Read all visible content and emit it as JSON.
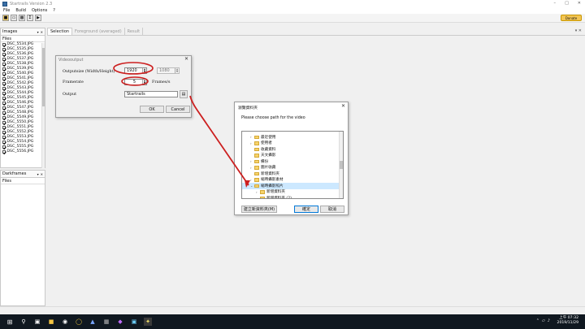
{
  "window": {
    "title": "Startrails Version 2.3"
  },
  "menu": [
    "File",
    "Build",
    "Options",
    "?"
  ],
  "toolbar": {
    "donate_label": "Donate"
  },
  "images_panel": {
    "title": "Images",
    "column": "Files",
    "files": [
      "DSC_5534.JPG",
      "DSC_5535.JPG",
      "DSC_5536.JPG",
      "DSC_5537.JPG",
      "DSC_5538.JPG",
      "DSC_5539.JPG",
      "DSC_5540.JPG",
      "DSC_5541.JPG",
      "DSC_5542.JPG",
      "DSC_5543.JPG",
      "DSC_5544.JPG",
      "DSC_5545.JPG",
      "DSC_5546.JPG",
      "DSC_5547.JPG",
      "DSC_5548.JPG",
      "DSC_5549.JPG",
      "DSC_5550.JPG",
      "DSC_5551.JPG",
      "DSC_5552.JPG",
      "DSC_5553.JPG",
      "DSC_5554.JPG",
      "DSC_5555.JPG",
      "DSC_5556.JPG"
    ]
  },
  "darkframes_panel": {
    "title": "Darkframes",
    "column": "Files"
  },
  "tabs": [
    "Selection",
    "Foreground (averaged)",
    "Result"
  ],
  "video_dialog": {
    "title": "Videooutput",
    "framesize_label": "Outputsize (Width/Height)",
    "width": "1920",
    "height": "1080",
    "fps_label": "Framerate",
    "fps": "5",
    "fps_unit": "Frames/s",
    "output_label": "Output",
    "output_value": "Startrails",
    "ok": "OK",
    "cancel": "Cancel"
  },
  "folder_dialog": {
    "title": "瀏覽資料夾",
    "prompt": "Please choose path for the video",
    "items": [
      {
        "label": "最近使用",
        "expand": true,
        "indent": 0
      },
      {
        "label": "使用者",
        "expand": true,
        "indent": 0
      },
      {
        "label": "收藏資料",
        "expand": false,
        "indent": 0
      },
      {
        "label": "天文攝影",
        "expand": false,
        "indent": 0
      },
      {
        "label": "備份",
        "expand": true,
        "indent": 0
      },
      {
        "label": "圖片收藏",
        "expand": true,
        "indent": 0
      },
      {
        "label": "新增資料夾",
        "expand": false,
        "indent": 0
      },
      {
        "label": "縮時攝影素材",
        "expand": true,
        "indent": 0
      },
      {
        "label": "縮時攝影照片",
        "expand": true,
        "indent": 0,
        "selected": true,
        "open": true
      },
      {
        "label": "新增資料夾",
        "expand": true,
        "indent": 1
      },
      {
        "label": "新增資料夾 (2)",
        "expand": false,
        "indent": 1
      }
    ],
    "new_folder": "建立新資料夾(M)",
    "ok": "確定",
    "cancel": "取消"
  },
  "taskbar": {
    "time": "上午 07:32",
    "date": "2019/11/29"
  },
  "colors": {
    "highlight": "#cc1f1f",
    "selection": "#cce8ff"
  }
}
